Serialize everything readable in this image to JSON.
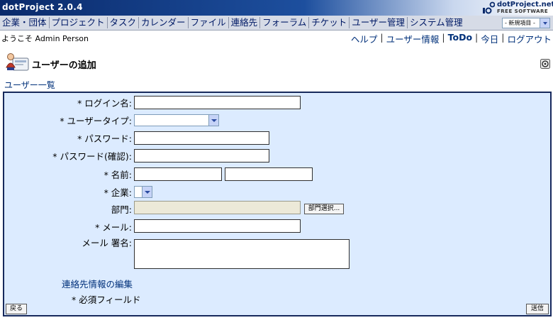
{
  "app": {
    "title": "dotProject 2.0.4",
    "brand_name": "dotProject.net",
    "brand_sub": "FREE SOFTWARE"
  },
  "menu": {
    "items": [
      "企業・団体",
      "プロジェクト",
      "タスク",
      "カレンダー",
      "ファイル",
      "連絡先",
      "フォーラム",
      "チケット",
      "ユーザー管理",
      "システム管理"
    ],
    "new_item_label": "- 新規項目 -"
  },
  "header": {
    "welcome": "ようこそ Admin Person",
    "links": [
      "ヘルプ",
      "ユーザー情報",
      "ToDo",
      "今日",
      "ログアウト"
    ]
  },
  "page": {
    "title": "ユーザーの追加",
    "breadcrumb": "ユーザー一覧"
  },
  "form": {
    "login_label": "* ログイン名:",
    "login_value": "",
    "user_type_label": "* ユーザータイプ:",
    "user_type_value": "",
    "password_label": "* パスワード:",
    "password_confirm_label": "* パスワード(確認):",
    "name_label": "* 名前:",
    "first_name_value": "",
    "last_name_value": "",
    "company_label": "* 企業:",
    "department_label": "部門:",
    "department_value": "",
    "department_button": "部門選択...",
    "email_label": "* メール:",
    "email_value": "",
    "signature_label": "メール 署名:",
    "signature_value": "",
    "contact_edit_link": "連絡先情報の編集",
    "required_note": "* 必須フィールド",
    "back_button": "戻る",
    "submit_button": "送信"
  },
  "colors": {
    "panel_bg": "#dcebff",
    "panel_border": "#17295c",
    "menubar_bg": "#d6dbe6",
    "link": "#00307a"
  }
}
